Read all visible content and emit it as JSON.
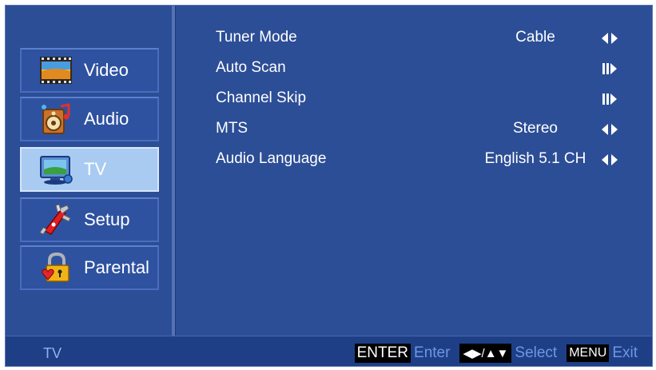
{
  "sidebar": {
    "items": [
      {
        "label": "Video",
        "icon": "video-icon",
        "active": false
      },
      {
        "label": "Audio",
        "icon": "audio-icon",
        "active": false
      },
      {
        "label": "TV",
        "icon": "tv-icon",
        "active": true
      },
      {
        "label": "Setup",
        "icon": "setup-icon",
        "active": false
      },
      {
        "label": "Parental",
        "icon": "parental-lock-icon",
        "active": false
      }
    ]
  },
  "settings": [
    {
      "name": "Tuner Mode",
      "value": "Cable",
      "control": "left-right-arrow-icon"
    },
    {
      "name": "Auto Scan",
      "value": "",
      "control": "enter-arrow-icon"
    },
    {
      "name": "Channel Skip",
      "value": "",
      "control": "enter-arrow-icon"
    },
    {
      "name": "MTS",
      "value": "Stereo",
      "control": "left-right-arrow-icon"
    },
    {
      "name": "Audio Language",
      "value": "English 5.1 CH",
      "control": "left-right-arrow-icon"
    }
  ],
  "footer": {
    "title": "TV",
    "enter_key": "ENTER",
    "enter_label": "Enter",
    "select_key": "◀▶/▲▼",
    "select_label": "Select",
    "menu_key": "MENU",
    "menu_label": "Exit"
  },
  "colors": {
    "background": "#2c4e96",
    "active_item": "#a9cbf2",
    "footer_hint": "#6d97e4"
  }
}
